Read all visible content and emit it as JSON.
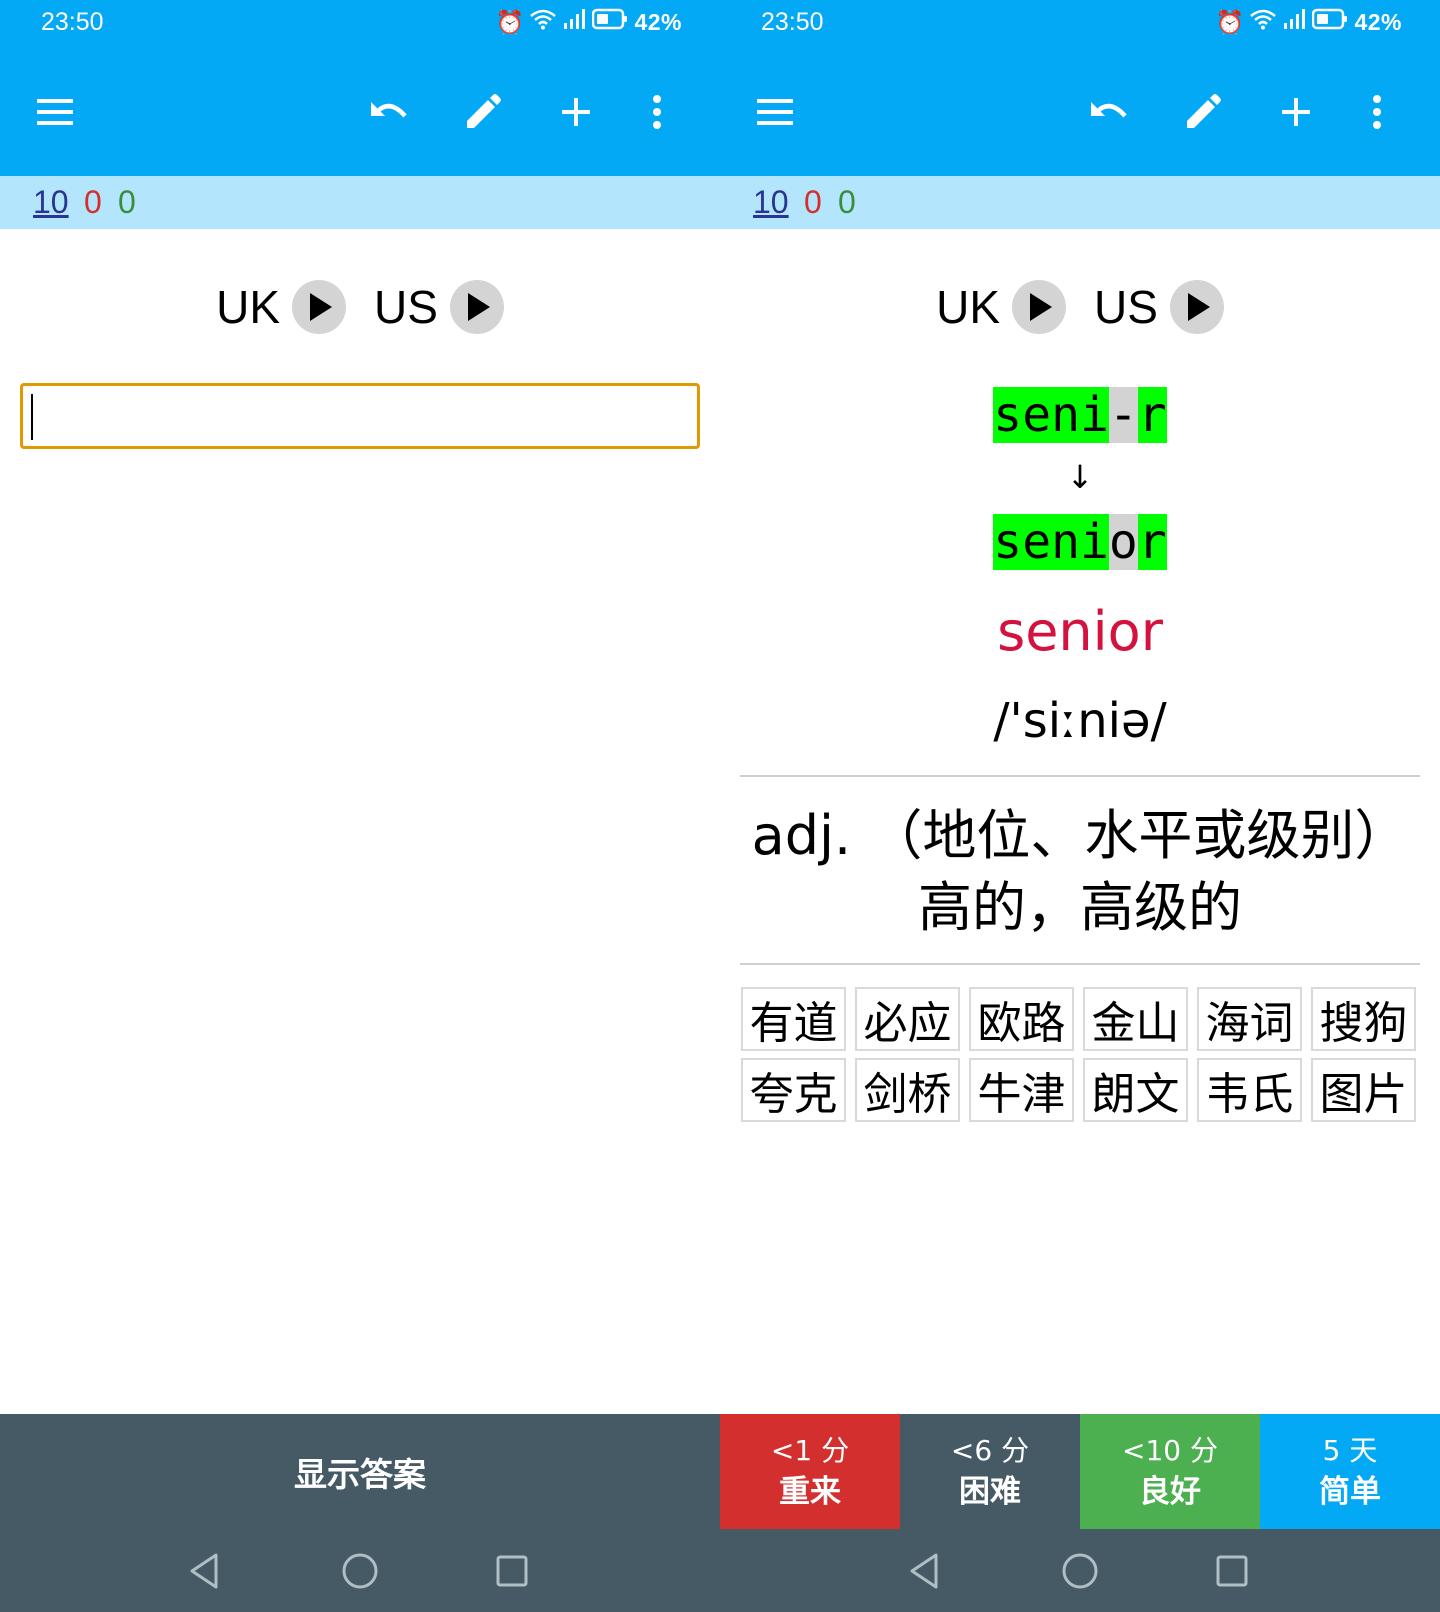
{
  "status": {
    "time": "23:50",
    "battery": "42%",
    "network": "4G"
  },
  "toolbar": {
    "menu_icon": "hamburger-menu-icon",
    "undo_icon": "undo-icon",
    "edit_icon": "pencil-icon",
    "add_icon": "plus-icon",
    "more_icon": "more-vertical-icon"
  },
  "counts": {
    "new": "10",
    "learning": "0",
    "review": "0"
  },
  "audio": {
    "uk_label": "UK",
    "us_label": "US"
  },
  "answer": {
    "typed": "seni-r",
    "correct": "senior",
    "arrow": "↓"
  },
  "word": "senior",
  "phonetic": "/'siːniə/",
  "definition": {
    "line1": "adj. （地位、水平或级别）",
    "line2": "高的，高级的"
  },
  "dictionaries": [
    "有道",
    "必应",
    "欧路",
    "金山",
    "海词",
    "搜狗",
    "夸克",
    "剑桥",
    "牛津",
    "朗文",
    "韦氏",
    "图片"
  ],
  "show_answer_label": "显示答案",
  "ratings": [
    {
      "time": "<1 分",
      "label": "重来",
      "color": "#d32f2f"
    },
    {
      "time": "<6 分",
      "label": "困难",
      "color": "#455a64"
    },
    {
      "time": "<10 分",
      "label": "良好",
      "color": "#4caf50"
    },
    {
      "time": "5 天",
      "label": "简单",
      "color": "#03a9f4"
    }
  ],
  "colors": {
    "primary": "#03a9f4",
    "counter_bar": "#b3e5fc",
    "input_focus": "#e09a00",
    "word": "#d3123e",
    "diff_match": "#00ff00",
    "diff_mismatch": "#d3d3d3",
    "bottom_bar": "#455a64"
  }
}
